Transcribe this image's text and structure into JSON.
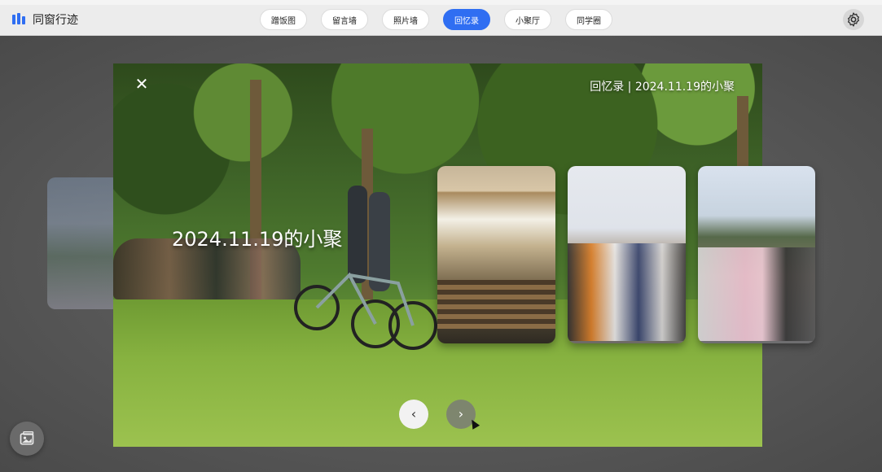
{
  "app": {
    "name": "同窗行迹",
    "logo_icon": "app-logo-icon"
  },
  "nav": {
    "items": [
      {
        "label": "蹭饭图"
      },
      {
        "label": "留言墙"
      },
      {
        "label": "照片墙"
      },
      {
        "label": "回忆录"
      },
      {
        "label": "小聚厅"
      },
      {
        "label": "同学圈"
      }
    ],
    "active_index": 3,
    "active_color": "#2f6ef2"
  },
  "header": {
    "settings_icon": "gear-icon"
  },
  "viewer": {
    "close_icon": "close-icon",
    "breadcrumb": "回忆录 | 2024.11.19的小聚",
    "album_title": "2024.11.19的小聚",
    "prev_icon": "chevron-left-icon",
    "next_icon": "chevron-right-icon"
  },
  "fab": {
    "icon": "photo-gallery-icon"
  }
}
